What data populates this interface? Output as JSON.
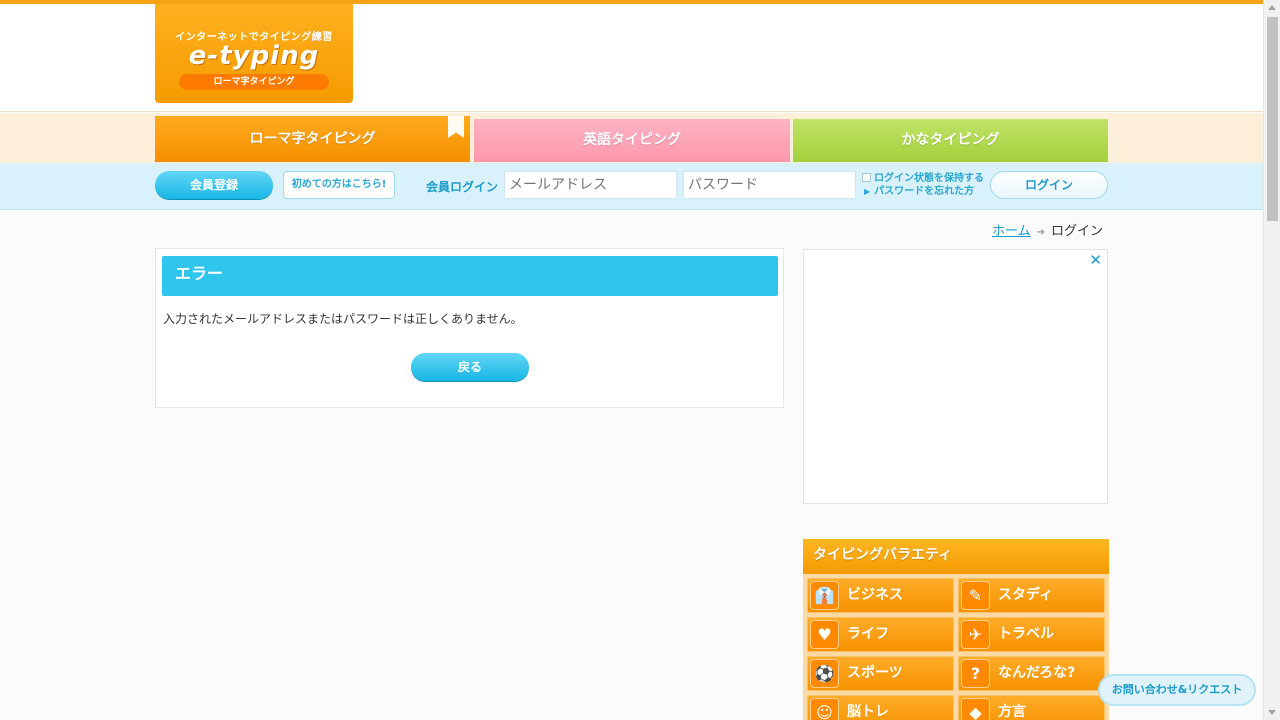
{
  "logo": {
    "tagline": "インターネットでタイピング練習",
    "brand": "e-typing",
    "pill": "ローマ字タイピング"
  },
  "tabs": [
    {
      "label": "ローマ字タイピング"
    },
    {
      "label": "英語タイピング"
    },
    {
      "label": "かなタイピング"
    }
  ],
  "login_bar": {
    "register_label": "会員登録",
    "first_time_label": "初めての方はこちら!",
    "login_heading": "会員ログイン",
    "email_placeholder": "メールアドレス",
    "password_placeholder": "パスワード",
    "keep_login_label": "ログイン状態を保持する",
    "forgot_password_label": "パスワードを忘れた方",
    "login_button": "ログイン"
  },
  "breadcrumb": {
    "home": "ホーム",
    "current": "ログイン"
  },
  "error_panel": {
    "title": "エラー",
    "message": "入力されたメールアドレスまたはパスワードは正しくありません。",
    "back_button": "戻る"
  },
  "ad": {
    "close_glyph": "✕"
  },
  "variety": {
    "title": "タイピングバラエティ",
    "items": [
      {
        "label": "ビジネス",
        "icon": "necktie-icon",
        "glyph": "👔"
      },
      {
        "label": "スタディ",
        "icon": "notebook-icon",
        "glyph": "✎"
      },
      {
        "label": "ライフ",
        "icon": "heart-icon",
        "glyph": "♥"
      },
      {
        "label": "トラベル",
        "icon": "airplane-icon",
        "glyph": "✈"
      },
      {
        "label": "スポーツ",
        "icon": "ball-icon",
        "glyph": "⚽"
      },
      {
        "label": "なんだろな?",
        "icon": "question-icon",
        "glyph": "?"
      },
      {
        "label": "脳トレ",
        "icon": "brain-icon",
        "glyph": "☺"
      },
      {
        "label": "方言",
        "icon": "map-icon",
        "glyph": "◆"
      }
    ]
  },
  "contact_label": "お問い合わせ&リクエスト"
}
